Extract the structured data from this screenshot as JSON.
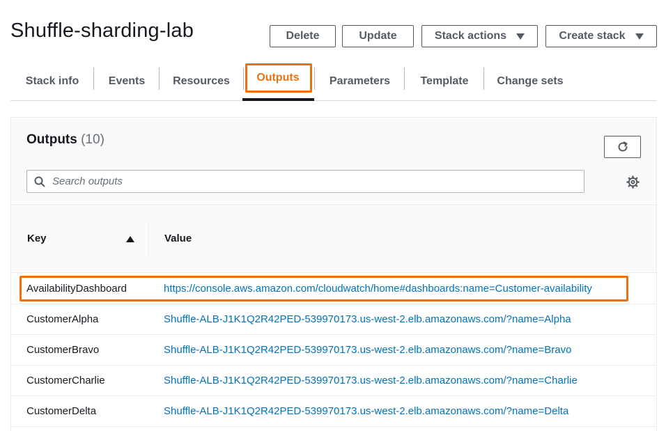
{
  "page": {
    "title": "Shuffle-sharding-lab"
  },
  "actions": {
    "delete_label": "Delete",
    "update_label": "Update",
    "stack_actions_label": "Stack actions",
    "create_stack_label": "Create stack"
  },
  "tabs": [
    {
      "label": "Stack info"
    },
    {
      "label": "Events"
    },
    {
      "label": "Resources"
    },
    {
      "label": "Outputs",
      "active": true
    },
    {
      "label": "Parameters"
    },
    {
      "label": "Template"
    },
    {
      "label": "Change sets"
    }
  ],
  "outputs": {
    "title": "Outputs",
    "count": "(10)",
    "search_placeholder": "Search outputs",
    "columns": {
      "key": "Key",
      "value": "Value"
    },
    "rows": [
      {
        "key": "AvailabilityDashboard",
        "value": "https://console.aws.amazon.com/cloudwatch/home#dashboards:name=Customer-availability"
      },
      {
        "key": "CustomerAlpha",
        "value": "Shuffle-ALB-J1K1Q2R42PED-539970173.us-west-2.elb.amazonaws.com/?name=Alpha"
      },
      {
        "key": "CustomerBravo",
        "value": "Shuffle-ALB-J1K1Q2R42PED-539970173.us-west-2.elb.amazonaws.com/?name=Bravo"
      },
      {
        "key": "CustomerCharlie",
        "value": "Shuffle-ALB-J1K1Q2R42PED-539970173.us-west-2.elb.amazonaws.com/?name=Charlie"
      },
      {
        "key": "CustomerDelta",
        "value": "Shuffle-ALB-J1K1Q2R42PED-539970173.us-west-2.elb.amazonaws.com/?name=Delta"
      }
    ]
  },
  "colors": {
    "accent": "#ec7211",
    "link": "#0073bb",
    "text": "#16191f"
  },
  "icons": {
    "refresh": "refresh-icon",
    "search": "search-icon",
    "settings": "gear-icon",
    "sort": "sort-ascending-icon",
    "dropdown": "caret-down-icon"
  }
}
